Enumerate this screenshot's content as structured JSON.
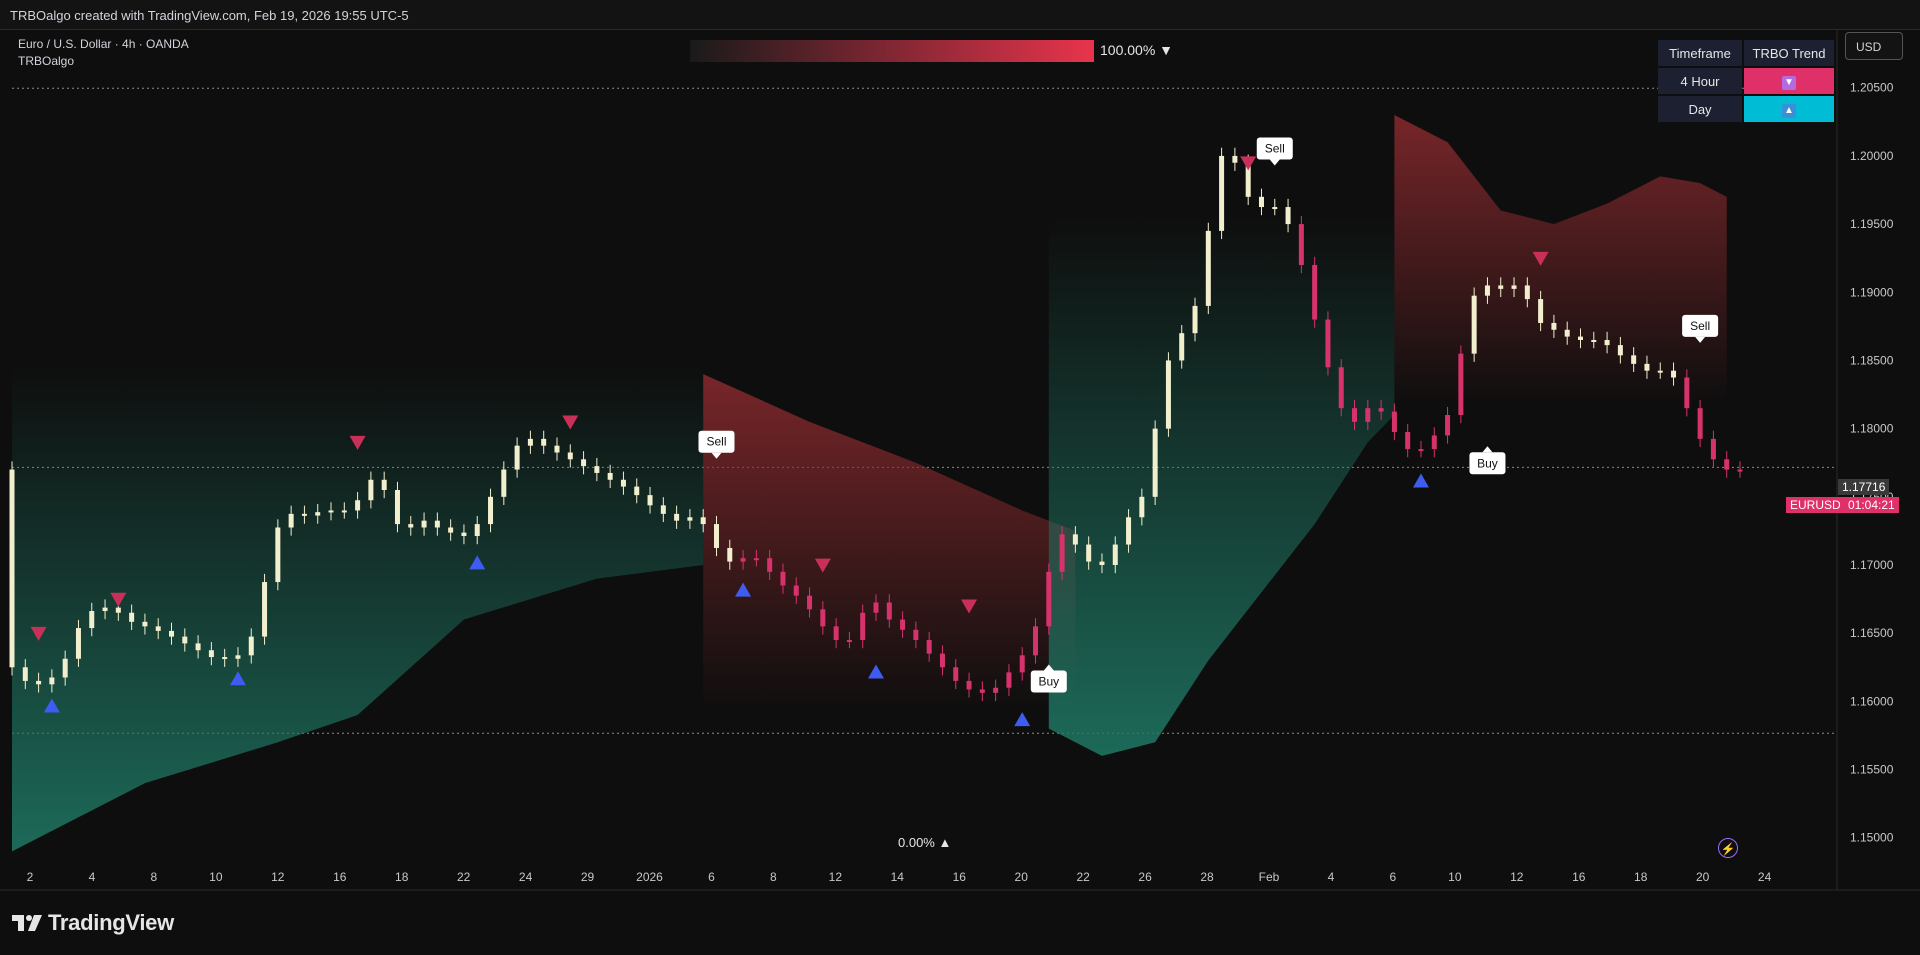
{
  "header": {
    "text": "TRBOalgo created with TradingView.com, Feb 19, 2026 19:55 UTC-5"
  },
  "legend": {
    "symbol": "Euro / U.S. Dollar · 4h · OANDA",
    "indicator": "TRBOalgo"
  },
  "heatmap": {
    "top_label": "100.00% ▼",
    "bottom_label": "0.00% ▲"
  },
  "currency_button": "USD",
  "trend_table": {
    "headers": [
      "Timeframe",
      "TRBO Trend"
    ],
    "rows": [
      {
        "timeframe": "4 Hour",
        "signal": "▼",
        "color": "#e0306a"
      },
      {
        "timeframe": "Day",
        "signal": "▲",
        "color": "#00bcd4"
      }
    ]
  },
  "price_badges": {
    "last_price": "1.17716",
    "symbol": "EURUSD",
    "countdown": "01:04:21"
  },
  "brand": "TradingView",
  "colors": {
    "bull": "#f2efcf",
    "bear": "#d6336c",
    "buy_arrow": "#3f5cf0",
    "sell_arrow": "#c8305a",
    "cloud_bull": "#1f7a66",
    "cloud_bear": "#8a2a2e",
    "background": "#0e0e0e"
  },
  "chart_data": {
    "type": "candlestick",
    "title": "Euro / U.S. Dollar · 4h · OANDA",
    "ylim": [
      1.148,
      1.2085
    ],
    "y_ticks": [
      "1.15000",
      "1.15500",
      "1.16000",
      "1.16500",
      "1.17000",
      "1.17500",
      "1.18000",
      "1.18500",
      "1.19000",
      "1.19500",
      "1.20000",
      "1.20500"
    ],
    "x_ticks": [
      "2",
      "4",
      "8",
      "10",
      "12",
      "16",
      "18",
      "22",
      "24",
      "29",
      "2026",
      "6",
      "8",
      "12",
      "14",
      "16",
      "20",
      "22",
      "26",
      "28",
      "Feb",
      "4",
      "6",
      "10",
      "12",
      "16",
      "18",
      "20",
      "24"
    ],
    "price_path": [
      [
        0,
        1.163
      ],
      [
        2,
        1.161
      ],
      [
        4,
        1.162
      ],
      [
        6,
        1.1665
      ],
      [
        8,
        1.167
      ],
      [
        9,
        1.166
      ],
      [
        12,
        1.165
      ],
      [
        14,
        1.164
      ],
      [
        16,
        1.163
      ],
      [
        18,
        1.1635
      ],
      [
        19,
        1.166
      ],
      [
        20,
        1.1715
      ],
      [
        21,
        1.174
      ],
      [
        22,
        1.1735
      ],
      [
        24,
        1.174
      ],
      [
        26,
        1.174
      ],
      [
        27,
        1.1755
      ],
      [
        28,
        1.177
      ],
      [
        29,
        1.174
      ],
      [
        30,
        1.172
      ],
      [
        31,
        1.1735
      ],
      [
        33,
        1.1725
      ],
      [
        35,
        1.172
      ],
      [
        36,
        1.174
      ],
      [
        37,
        1.176
      ],
      [
        38,
        1.178
      ],
      [
        39,
        1.1795
      ],
      [
        40,
        1.179
      ],
      [
        42,
        1.178
      ],
      [
        43,
        1.1775
      ],
      [
        45,
        1.1765
      ],
      [
        47,
        1.1755
      ],
      [
        49,
        1.174
      ],
      [
        51,
        1.173
      ],
      [
        52,
        1.174
      ],
      [
        53,
        1.172
      ],
      [
        54,
        1.1705
      ],
      [
        55,
        1.17
      ],
      [
        56,
        1.171
      ],
      [
        57,
        1.17
      ],
      [
        58,
        1.169
      ],
      [
        59,
        1.168
      ],
      [
        60,
        1.1675
      ],
      [
        61,
        1.166
      ],
      [
        62,
        1.165
      ],
      [
        63,
        1.164
      ],
      [
        64,
        1.165
      ],
      [
        65,
        1.168
      ],
      [
        66,
        1.1665
      ],
      [
        67,
        1.1655
      ],
      [
        68,
        1.165
      ],
      [
        69,
        1.164
      ],
      [
        70,
        1.163
      ],
      [
        72,
        1.161
      ],
      [
        74,
        1.1605
      ],
      [
        75,
        1.1615
      ],
      [
        77,
        1.164
      ],
      [
        78,
        1.167
      ],
      [
        79,
        1.172
      ],
      [
        80,
        1.1725
      ],
      [
        81,
        1.1705
      ],
      [
        82,
        1.17
      ],
      [
        83,
        1.17
      ],
      [
        84,
        1.173
      ],
      [
        85,
        1.174
      ],
      [
        86,
        1.176
      ],
      [
        87,
        1.184
      ],
      [
        88,
        1.186
      ],
      [
        89,
        1.188
      ],
      [
        90,
        1.19
      ],
      [
        91,
        1.199
      ],
      [
        92,
        1.201
      ],
      [
        93,
        1.198
      ],
      [
        94,
        1.196
      ],
      [
        95,
        1.1965
      ],
      [
        96,
        1.196
      ],
      [
        97,
        1.194
      ],
      [
        98,
        1.19
      ],
      [
        99,
        1.186
      ],
      [
        100,
        1.183
      ],
      [
        101,
        1.18
      ],
      [
        102,
        1.181
      ],
      [
        103,
        1.182
      ],
      [
        104,
        1.1805
      ],
      [
        105,
        1.179
      ],
      [
        106,
        1.178
      ],
      [
        107,
        1.179
      ],
      [
        108,
        1.18
      ],
      [
        109,
        1.182
      ],
      [
        110,
        1.189
      ],
      [
        111,
        1.1905
      ],
      [
        112,
        1.1905
      ],
      [
        113,
        1.19
      ],
      [
        114,
        1.191
      ],
      [
        115,
        1.188
      ],
      [
        116,
        1.1875
      ],
      [
        118,
        1.1865
      ],
      [
        120,
        1.1865
      ],
      [
        122,
        1.185
      ],
      [
        124,
        1.184
      ],
      [
        125,
        1.1845
      ],
      [
        126,
        1.183
      ],
      [
        127,
        1.18
      ],
      [
        128,
        1.1785
      ],
      [
        129,
        1.177
      ]
    ],
    "bear_ranges": [
      [
        55,
        79
      ],
      [
        97,
        109
      ],
      [
        126,
        130
      ]
    ],
    "buy_arrows": [
      [
        3,
        1.1605
      ],
      [
        17,
        1.1625
      ],
      [
        35,
        1.171
      ],
      [
        55,
        1.169
      ],
      [
        65,
        1.163
      ],
      [
        76,
        1.1595
      ],
      [
        106,
        1.177
      ]
    ],
    "sell_arrows": [
      [
        2,
        1.164
      ],
      [
        8,
        1.1665
      ],
      [
        26,
        1.178
      ],
      [
        42,
        1.1795
      ],
      [
        61,
        1.169
      ],
      [
        72,
        1.166
      ],
      [
        93,
        1.1985
      ],
      [
        115,
        1.1915
      ]
    ],
    "labels": [
      {
        "text": "Sell",
        "x": 53,
        "y": 1.1775,
        "side": "above"
      },
      {
        "text": "Sell",
        "x": 95,
        "y": 1.199,
        "side": "above"
      },
      {
        "text": "Sell",
        "x": 127,
        "y": 1.186,
        "side": "above"
      },
      {
        "text": "Buy",
        "x": 78,
        "y": 1.163,
        "side": "below"
      },
      {
        "text": "Buy",
        "x": 111,
        "y": 1.179,
        "side": "below"
      }
    ],
    "bear_cloud": [
      [
        52,
        1.184
      ],
      [
        60,
        1.1805
      ],
      [
        68,
        1.1775
      ],
      [
        76,
        1.174
      ],
      [
        80,
        1.1725
      ]
    ],
    "bear_cloud_2": [
      [
        104,
        1.203
      ],
      [
        108,
        1.201
      ],
      [
        112,
        1.196
      ],
      [
        116,
        1.195
      ],
      [
        120,
        1.1965
      ],
      [
        124,
        1.1985
      ],
      [
        127,
        1.198
      ],
      [
        129,
        1.197
      ]
    ],
    "bull_cloud": [
      [
        0,
        1.149
      ],
      [
        10,
        1.154
      ],
      [
        20,
        1.157
      ],
      [
        26,
        1.159
      ],
      [
        34,
        1.166
      ],
      [
        44,
        1.169
      ],
      [
        52,
        1.17
      ]
    ],
    "bull_cloud_2": [
      [
        78,
        1.158
      ],
      [
        82,
        1.156
      ],
      [
        86,
        1.157
      ],
      [
        90,
        1.163
      ],
      [
        94,
        1.168
      ],
      [
        98,
        1.173
      ],
      [
        102,
        1.179
      ],
      [
        104,
        1.181
      ]
    ],
    "last_price": 1.17716,
    "reference_lines": [
      1.205,
      1.1577
    ]
  }
}
